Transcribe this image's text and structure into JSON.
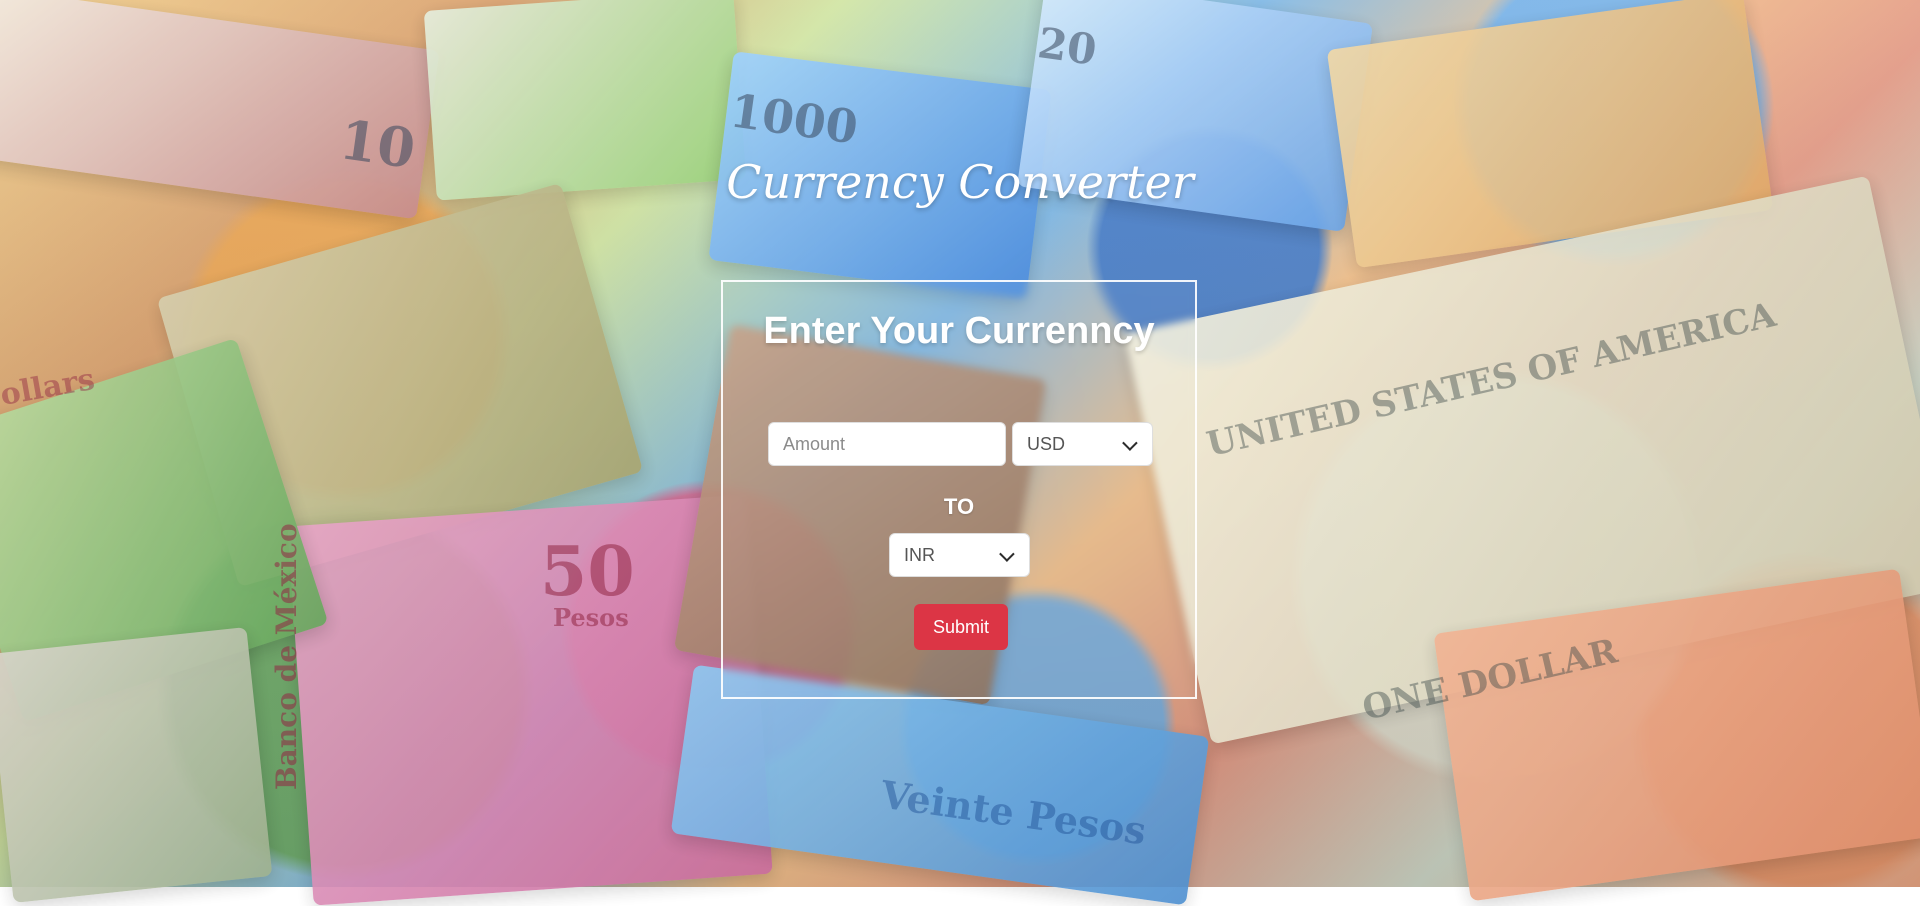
{
  "page": {
    "title": "Currency Converter"
  },
  "panel": {
    "heading": "Enter Your Currenncy",
    "amount_placeholder": "Amount",
    "from_currency": "USD",
    "to_label": "TO",
    "to_currency": "INR",
    "submit_label": "Submit"
  },
  "background": {
    "visible_text": [
      "1000",
      "10",
      "20",
      "50",
      "Pesos",
      "Veinte Pesos",
      "UNITED STATES OF AMERICA",
      "ONE DOLLAR",
      "Banco de México",
      "ollars"
    ]
  },
  "colors": {
    "submit": "#dc3545",
    "panel_border": "#ffffff",
    "text": "#ffffff"
  }
}
